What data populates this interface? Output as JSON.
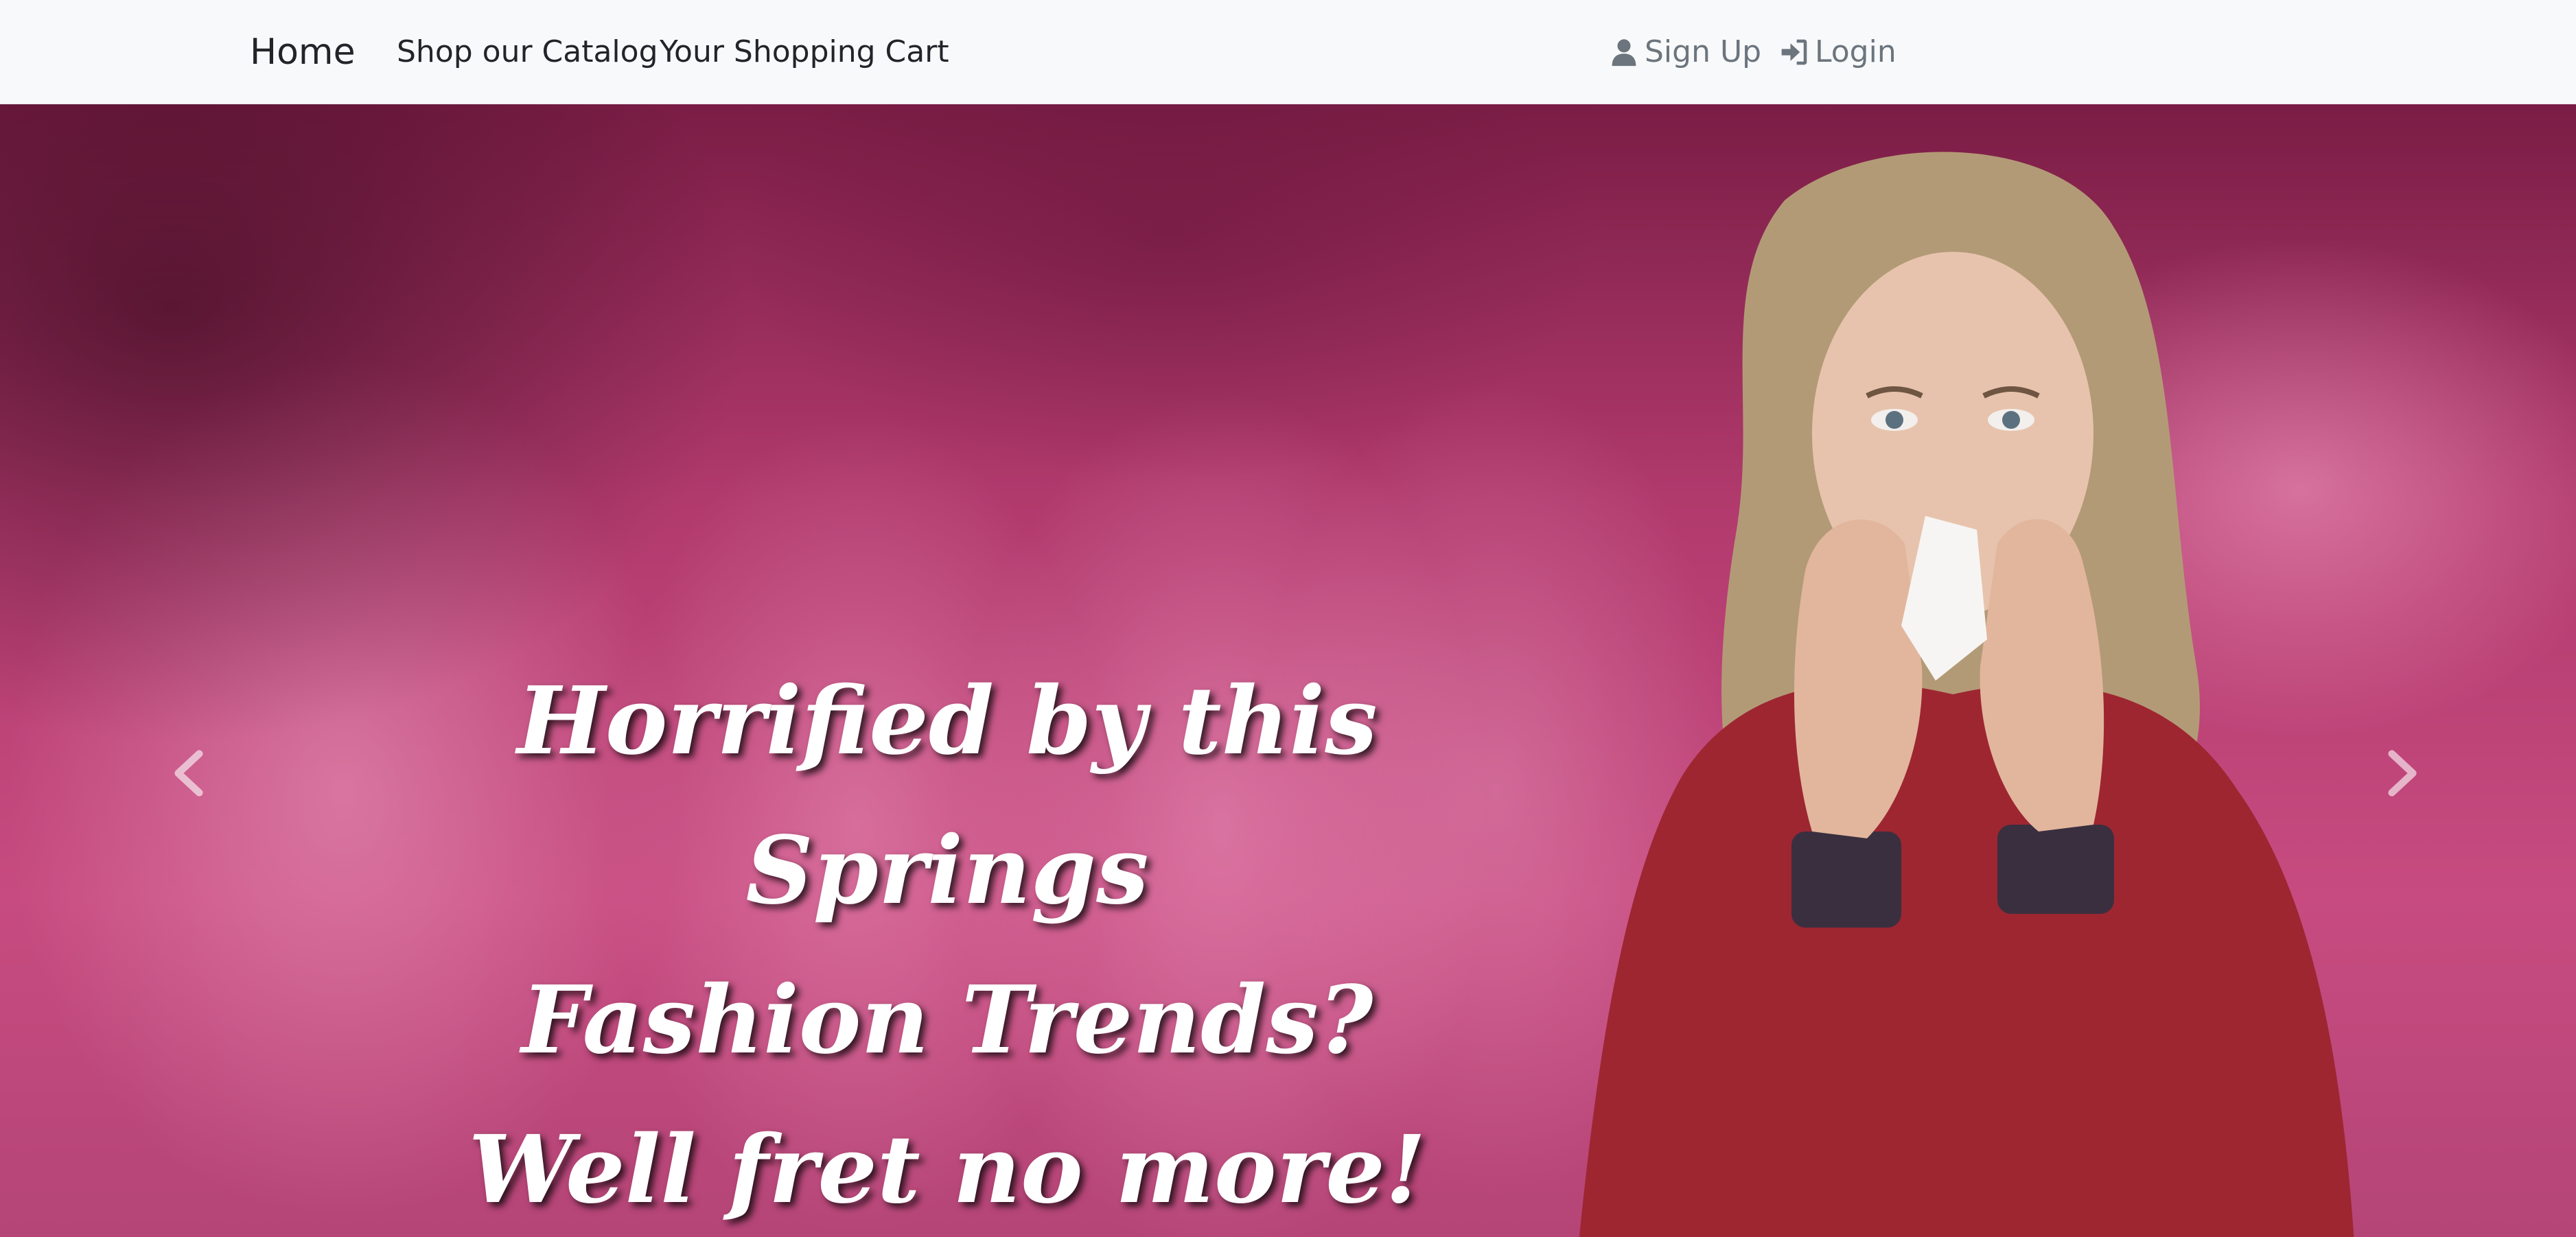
{
  "navbar": {
    "brand": "Home",
    "links": [
      {
        "label": "Shop our Catalog"
      },
      {
        "label": "Your Shopping Cart"
      }
    ],
    "auth": [
      {
        "label": "Sign Up",
        "icon": "user-icon"
      },
      {
        "label": "Login",
        "icon": "login-icon"
      }
    ]
  },
  "hero": {
    "caption_lines": [
      "Horrified by this Springs",
      "Fashion Trends?",
      "Well fret no more!"
    ],
    "slides": 3,
    "active_slide": 1
  },
  "colors": {
    "navbar_bg": "#f8f9fa",
    "hero_tint": "#c74b80",
    "caption_text": "#ffffff"
  }
}
